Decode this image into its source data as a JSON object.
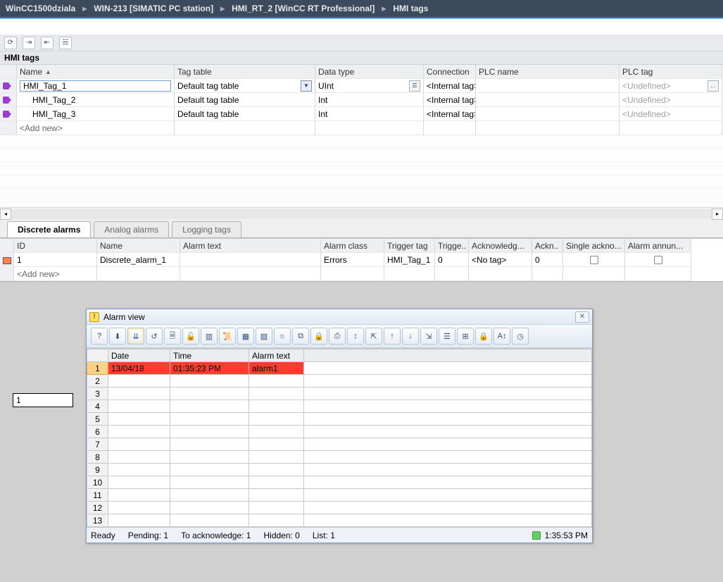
{
  "breadcrumb": {
    "items": [
      "WinCC1500dziala",
      "WIN-213 [SIMATIC PC station]",
      "HMI_RT_2 [WinCC RT Professional]",
      "HMI tags"
    ]
  },
  "section_title": "HMI tags",
  "tag_table": {
    "headers": [
      "Name",
      "Tag table",
      "Data type",
      "Connection",
      "PLC name",
      "PLC tag"
    ],
    "rows": [
      {
        "name": "HMI_Tag_1",
        "tag_table": "Default tag table",
        "data_type": "UInt",
        "connection": "<Internal tag>",
        "plc_name": "",
        "plc_tag": "<Undefined>",
        "editing": true
      },
      {
        "name": "HMI_Tag_2",
        "tag_table": "Default tag table",
        "data_type": "Int",
        "connection": "<Internal tag>",
        "plc_name": "",
        "plc_tag": "<Undefined>",
        "editing": false
      },
      {
        "name": "HMI_Tag_3",
        "tag_table": "Default tag table",
        "data_type": "Int",
        "connection": "<Internal tag>",
        "plc_name": "",
        "plc_tag": "<Undefined>",
        "editing": false
      }
    ],
    "add_new": "<Add new>"
  },
  "bottom_tabs": {
    "active": 0,
    "items": [
      "Discrete alarms",
      "Analog alarms",
      "Logging tags"
    ]
  },
  "discrete_alarms": {
    "headers": [
      "ID",
      "Name",
      "Alarm text",
      "Alarm class",
      "Trigger tag",
      "Trigge..",
      "Acknowledg...",
      "Ackn..",
      "Single ackno...",
      "Alarm annun..."
    ],
    "rows": [
      {
        "id": "1",
        "name": "Discrete_alarm_1",
        "alarm_text": "",
        "alarm_class": "Errors",
        "trigger_tag": "HMI_Tag_1",
        "trigger_bit": "0",
        "ack_tag": "<No tag>",
        "ack_bit": "0",
        "single_ack": false,
        "annun": false
      }
    ],
    "add_new": "<Add new>"
  },
  "orphan_value": "1",
  "alarm_view": {
    "title": "Alarm view",
    "toolbar_icons": [
      "help-icon",
      "single-ack-icon",
      "group-ack-icon",
      "loop-in-icon",
      "print-alarm-icon",
      "lock-open-icon",
      "stats-icon",
      "scroll-icon",
      "filter-1-icon",
      "filter-2-icon",
      "lamp-icon",
      "copy-icon",
      "lock-icon",
      "print-icon",
      "vscroll-icon",
      "first-icon",
      "up-icon",
      "down-icon",
      "last-icon",
      "list-icon",
      "tree-icon",
      "lock2-icon",
      "sort-icon",
      "clock-icon"
    ],
    "columns": [
      "Date",
      "Time",
      "Alarm text"
    ],
    "rows": [
      {
        "n": "1",
        "date": "13/04/18",
        "time": "01:35:23 PM",
        "text": "alarm1",
        "red": true
      }
    ],
    "blank_count": 12,
    "status": {
      "ready": "Ready",
      "pending": "Pending: 1",
      "ack": "To acknowledge: 1",
      "hidden": "Hidden: 0",
      "list": "List: 1",
      "time": "1:35:53 PM"
    }
  }
}
